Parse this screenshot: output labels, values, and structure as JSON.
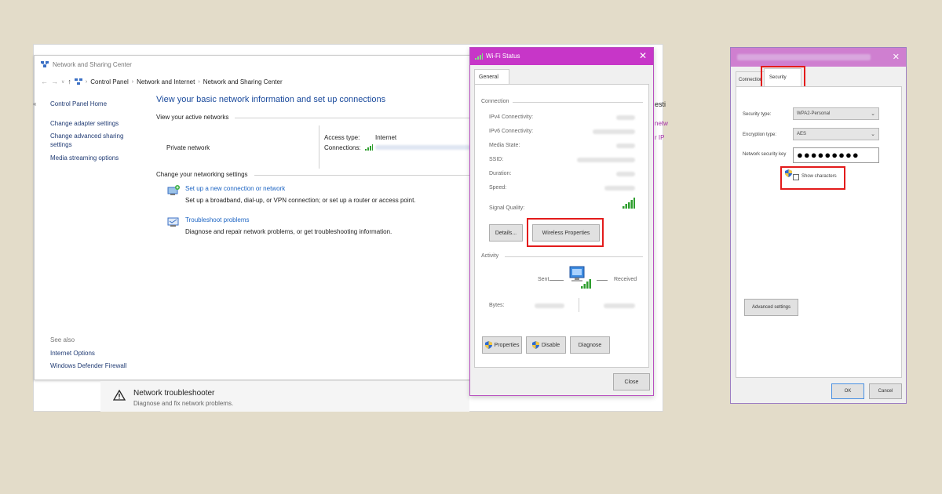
{
  "colors": {
    "background": "#e3dcc9",
    "link": "#1c64c3",
    "heading": "#1a4a9c",
    "accent_titlebar": "#c736c8",
    "highlight": "#e31b1b"
  },
  "nsc": {
    "title": "Network and Sharing Center",
    "breadcrumb": [
      "Control Panel",
      "Network and Internet",
      "Network and Sharing Center"
    ],
    "sidebar": {
      "links": [
        "Control Panel Home",
        "Change adapter settings",
        "Change advanced sharing",
        "settings",
        "Media streaming options"
      ],
      "see_also_label": "See also",
      "see_also": [
        "Internet Options",
        "Windows Defender Firewall"
      ]
    },
    "main": {
      "heading": "View your basic network information and set up connections",
      "active_networks_label": "View your active networks",
      "network_name": "Private network",
      "access_type_label": "Access type:",
      "access_type_value": "Internet",
      "connections_label": "Connections:",
      "change_settings_label": "Change your networking settings",
      "tasks": [
        {
          "title": "Set up a new connection or network",
          "desc": "Set up a broadband, dial-up, or VPN connection; or set up a router or access point."
        },
        {
          "title": "Troubleshoot problems",
          "desc": "Diagnose and repair network problems, or get troubleshooting information."
        }
      ]
    }
  },
  "troubleshooter": {
    "title": "Network troubleshooter",
    "subtitle": "Diagnose and fix network problems."
  },
  "wifi_status": {
    "title": "Wi-Fi Status",
    "tab": "General",
    "connection_section": "Connection",
    "rows": [
      "IPv4 Connectivity:",
      "IPv6 Connectivity:",
      "Media State:",
      "SSID:",
      "Duration:",
      "Speed:"
    ],
    "signal_quality": "Signal Quality:",
    "details_button": "Details...",
    "wireless_properties_button": "Wireless Properties",
    "activity_section": "Activity",
    "sent_label": "Sent",
    "received_label": "Received",
    "bytes_label": "Bytes:",
    "properties_button": "Properties",
    "disable_button": "Disable",
    "diagnose_button": "Diagnose",
    "close_button": "Close"
  },
  "wireless_props": {
    "tabs": [
      "Connection",
      "Security"
    ],
    "security_type_label": "Security type:",
    "security_type_value": "WPA2-Personal",
    "encryption_type_label": "Encryption type:",
    "encryption_type_value": "AES",
    "network_key_label": "Network security key",
    "network_key_value": "●●●●●●●●●",
    "show_characters_label": "Show characters",
    "advanced_button": "Advanced settings",
    "ok_button": "OK",
    "cancel_button": "Cancel"
  }
}
